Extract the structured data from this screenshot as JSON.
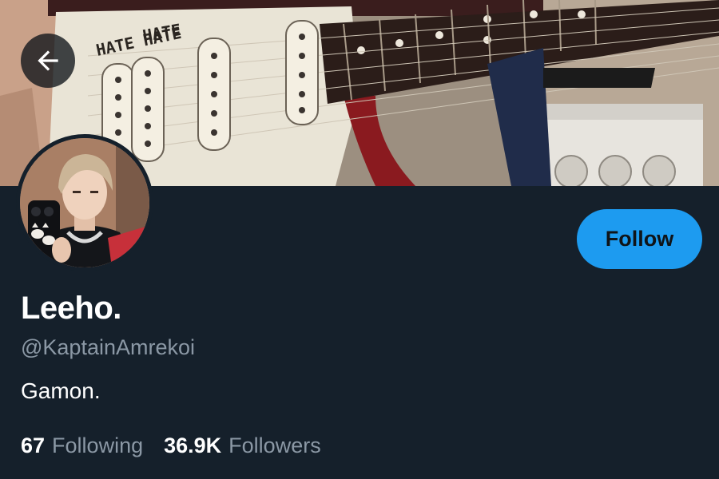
{
  "header": {
    "back_icon": "arrow-left-icon"
  },
  "profile": {
    "display_name": "Leeho.",
    "handle": "@KaptainAmrekoi",
    "bio": "Gamon.",
    "follow_label": "Follow",
    "banner_text": "HATE HATE HATE"
  },
  "stats": {
    "following_count": "67",
    "following_label": "Following",
    "followers_count": "36.9K",
    "followers_label": "Followers"
  },
  "colors": {
    "background": "#15202b",
    "accent": "#1d9bf0",
    "secondary_text": "#8b98a5"
  }
}
